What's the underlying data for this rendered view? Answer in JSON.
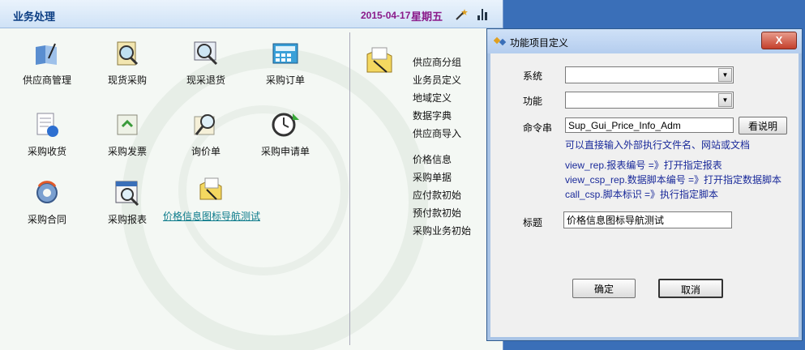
{
  "main": {
    "title": "业务处理",
    "date": "2015-04-17",
    "weekday": "星期五",
    "tiles": [
      {
        "label": "供应商管理",
        "icon": "supplier-management-icon"
      },
      {
        "label": "现货采购",
        "icon": "spot-purchase-icon"
      },
      {
        "label": "现采退货",
        "icon": "purchase-return-icon"
      },
      {
        "label": "采购订单",
        "icon": "purchase-order-icon"
      },
      {
        "label": "采购收货",
        "icon": "purchase-receipt-icon"
      },
      {
        "label": "采购发票",
        "icon": "purchase-invoice-icon"
      },
      {
        "label": "询价单",
        "icon": "inquiry-icon"
      },
      {
        "label": "采购申请单",
        "icon": "purchase-request-icon"
      },
      {
        "label": "采购合同",
        "icon": "purchase-contract-icon"
      },
      {
        "label": "采购报表",
        "icon": "purchase-report-icon"
      },
      {
        "label": "价格信息图标导航测试",
        "icon": "price-info-icon"
      }
    ],
    "right_list": [
      "供应商分组",
      "业务员定义",
      "地域定义",
      "数据字典",
      "供应商导入",
      "价格信息",
      "采购单据",
      "应付款初始",
      "预付款初始",
      "采购业务初始"
    ]
  },
  "dialog": {
    "title": "功能项目定义",
    "close_label": "X",
    "system_label": "系统",
    "system_value": "",
    "function_label": "功能",
    "function_value": "",
    "command_label": "命令串",
    "command_value": "Sup_Gui_Price_Info_Adm",
    "view_help_label": "看说明",
    "hint_main": "可以直接输入外部执行文件名、网站或文档",
    "hint_1": "view_rep.报表编号   =》打开指定报表",
    "hint_2": "view_csp_rep.数据脚本编号   =》打开指定数据脚本",
    "hint_3": "call_csp.脚本标识   =》执行指定脚本",
    "caption_label": "标题",
    "caption_value": "价格信息图标导航测试",
    "ok_label": "确定",
    "cancel_label": "取消"
  },
  "colors": {
    "accent": "#0a3c82",
    "date": "#8a1a8a",
    "hint": "#1a2a9a"
  }
}
